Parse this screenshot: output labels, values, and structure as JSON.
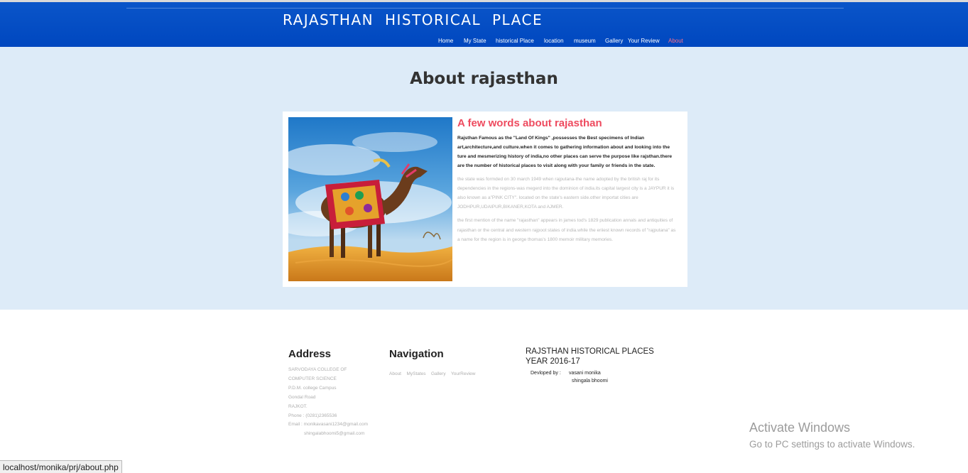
{
  "header": {
    "title": "RAJASTHAN HISTORICAL PLACE",
    "nav": [
      {
        "label": "Home",
        "active": false
      },
      {
        "label": "My State",
        "active": false
      },
      {
        "label": "historical Place",
        "active": false
      },
      {
        "label": "location",
        "active": false
      },
      {
        "label": "museum",
        "active": false
      },
      {
        "label": "Gallery",
        "active": false
      },
      {
        "label": "Your Review",
        "active": false
      },
      {
        "label": "About",
        "active": true
      }
    ],
    "colors": {
      "bar": "#0047bf",
      "nav_active": "#ff6f86"
    }
  },
  "main": {
    "title": "About rajasthan",
    "image": "camel-in-desert-photo",
    "heading": "A few words about rajasthan",
    "lead": "Rajsthan Famous as the \"Land Of Kings\" ,possesses the Best specimens of Indian art,architecture,and culture.when it comes to gathering information about and looking into the ture and mesmerizing history of india,no other places can serve the purpose like rajsthan.there are the number of historical places to visit along with your family or friends in the state.",
    "para1": "the state was formded on 30 march 1949 when rajputana-the name adopted by the british raj for its dependencies in the regions-was megerd into the dominion of india.its capital largest city is a JAYPUR it is also known as a\"PINK CITY\". located on the state's eastern side.other importat cities are JODHPUR,UDAIPUR,BIKANER,KOTA and AJMER.",
    "para2": "the first mention of the name \"rajasthan\" appears in james tod's 1829 publication annals and antiquities of rajasthan or the central and western rajpoot states of india.while the eriiest known records of \"rajputana\" as a name for the region is in george thomas's 1800 memoir military memories.",
    "colors": {
      "background": "#ddebf8",
      "heading": "#ee4b5f"
    }
  },
  "footer": {
    "address": {
      "title": "Address",
      "lines": [
        "SARVODAYA COLLEGE OF",
        "COMPUTER SCIENCE",
        "P.D.M. college Campus",
        "Gondal Road",
        "RAJKOT.",
        "Phone : (0281)2365536",
        "Email : monikavasani1234@gmail.com",
        "shingalabhoomi5@gmail.com"
      ]
    },
    "navigation": {
      "title": "Navigation",
      "links": [
        "About",
        "MyStates",
        "Gallery",
        "YourReview"
      ]
    },
    "info": {
      "title": "RAJSTHAN HISTORICAL PLACES YEAR 2016-17",
      "dev_label": "Devloped by :",
      "developers": [
        "vasani monika",
        "shingala bhoomi"
      ]
    }
  },
  "watermark": {
    "line1": "Activate Windows",
    "line2": "Go to PC settings to activate Windows."
  },
  "statusbar": {
    "url": "localhost/monika/prj/about.php"
  }
}
